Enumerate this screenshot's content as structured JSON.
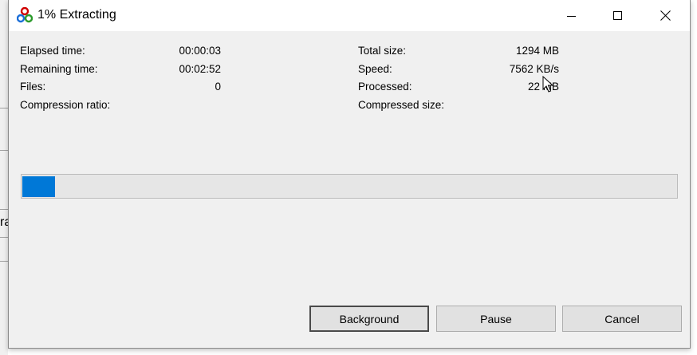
{
  "window": {
    "title": "1% Extracting"
  },
  "background_window": {
    "partial_text": "ra"
  },
  "stats": {
    "elapsed_label": "Elapsed time:",
    "elapsed_value": "00:00:03",
    "remaining_label": "Remaining time:",
    "remaining_value": "00:02:52",
    "files_label": "Files:",
    "files_value": "0",
    "compression_label": "Compression ratio:",
    "compression_value": "",
    "total_size_label": "Total size:",
    "total_size_value": "1294 MB",
    "speed_label": "Speed:",
    "speed_value": "7562 KB/s",
    "processed_label": "Processed:",
    "processed_value": "22 MB",
    "compressed_size_label": "Compressed size:",
    "compressed_size_value": ""
  },
  "progress": {
    "percent": 5
  },
  "buttons": {
    "background": "Background",
    "pause": "Pause",
    "cancel": "Cancel"
  },
  "colors": {
    "progress_fill": "#0078d7",
    "dialog_bg": "#f0f0f0",
    "titlebar_bg": "#ffffff"
  },
  "icons": {
    "app": "7zip-style-logo-icon",
    "minimize": "minimize-icon",
    "maximize": "maximize-icon",
    "close": "close-icon",
    "cursor": "mouse-pointer-icon"
  }
}
